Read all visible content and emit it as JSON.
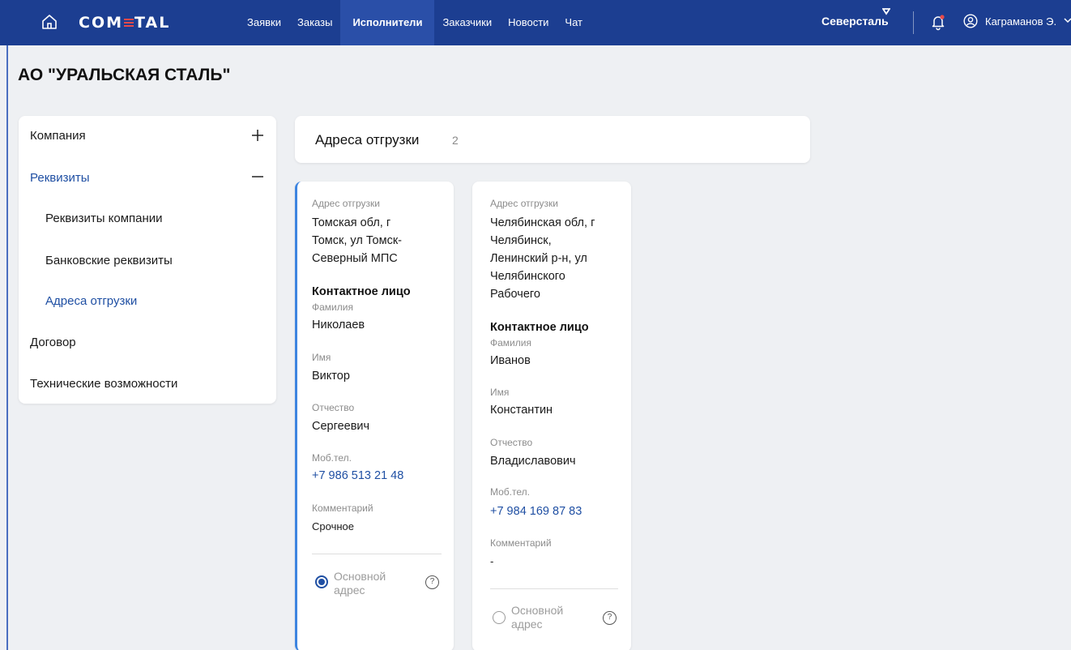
{
  "header": {
    "logo": "COM",
    "logo_tail": "TAL",
    "nav": [
      "Заявки",
      "Заказы",
      "Исполнители",
      "Заказчики",
      "Новости",
      "Чат"
    ],
    "active_nav": "Исполнители",
    "brand": "Северсталь",
    "user": "Каграманов Э."
  },
  "page": {
    "title": "АО \"УРАЛЬСКАЯ СТАЛЬ\""
  },
  "sidebar": {
    "items": [
      {
        "label": "Компания"
      },
      {
        "label": "Реквизиты"
      },
      {
        "label": "Реквизиты компании"
      },
      {
        "label": "Банковские реквизиты"
      },
      {
        "label": "Адреса отгрузки"
      },
      {
        "label": "Договор"
      },
      {
        "label": "Технические возможности"
      }
    ]
  },
  "section": {
    "title": "Адреса отгрузки",
    "count": "2"
  },
  "labels": {
    "address": "Адрес отгрузки",
    "contact": "Контактное лицо",
    "last_name": "Фамилия",
    "first_name": "Имя",
    "middle_name": "Отчество",
    "phone": "Моб.тел.",
    "comment": "Комментарий",
    "main_address_1": "Основной",
    "main_address_2": "адрес",
    "help": "?"
  },
  "cards": [
    {
      "address_lines": [
        "Томская обл, г",
        "Томск, ул Томск-",
        "Северный МПС"
      ],
      "last_name": "Николаев",
      "first_name": "Виктор",
      "middle_name": "Сергеевич",
      "phone": "+7 986 513 21 48",
      "comment": "Срочное",
      "is_main": true
    },
    {
      "address_lines": [
        "Челябинская обл, г",
        "Челябинск,",
        "Ленинский р-н, ул",
        "Челябинского",
        "Рабочего"
      ],
      "last_name": "Иванов",
      "first_name": "Константин",
      "middle_name": "Владиславович",
      "phone": "+7 984 169 87 83",
      "comment": "-",
      "is_main": false
    }
  ]
}
